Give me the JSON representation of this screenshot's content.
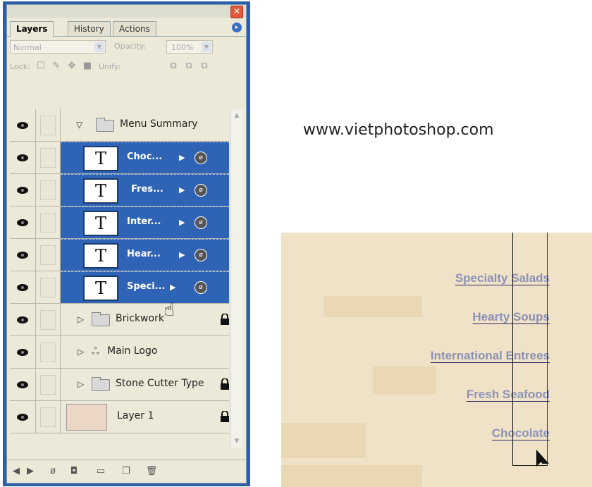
{
  "panel": {
    "close_glyph": "✕",
    "tabs": [
      "Layers",
      "History",
      "Actions"
    ],
    "menu_glyph": "▸",
    "blend_mode": "Normal",
    "opacity_label": "Opacity:",
    "opacity_value": "100%",
    "lock_label": "Lock:",
    "unify_label": "Unify:",
    "layers": [
      {
        "name": "Menu Summary",
        "kind": "group",
        "expanded": true
      },
      {
        "name": "Choc...",
        "kind": "text",
        "selected": true
      },
      {
        "name": "Fres...",
        "kind": "text",
        "selected": true
      },
      {
        "name": "Inter...",
        "kind": "text",
        "selected": true
      },
      {
        "name": "Hear...",
        "kind": "text",
        "selected": true
      },
      {
        "name": "Speci...",
        "kind": "text",
        "selected": true
      },
      {
        "name": "Brickwork",
        "kind": "group",
        "locked": true
      },
      {
        "name": "Main Logo",
        "kind": "smart"
      },
      {
        "name": "Stone Cutter Type",
        "kind": "group",
        "locked": true
      },
      {
        "name": "Layer 1",
        "kind": "raster",
        "locked": true
      }
    ],
    "text_thumb_glyph": "T",
    "bottom_icons": [
      "link-layers-icon",
      "layer-style-icon",
      "adjustment-layer-icon",
      "mask-icon",
      "new-group-icon",
      "new-layer-icon",
      "trash-icon"
    ]
  },
  "website": "www.vietphotoshop.com",
  "preview": {
    "menu_items": [
      "Specialty Salads",
      "Hearty Soups",
      "International Entrees",
      "Fresh Seafood",
      "Chocolate"
    ],
    "text_color": "#8c92b8",
    "underline_color": "#2b2a6b"
  },
  "colors": {
    "selection": "#2f63b5",
    "panel_frame": "#2c5fa8",
    "panel_bg": "#ece9d8"
  }
}
